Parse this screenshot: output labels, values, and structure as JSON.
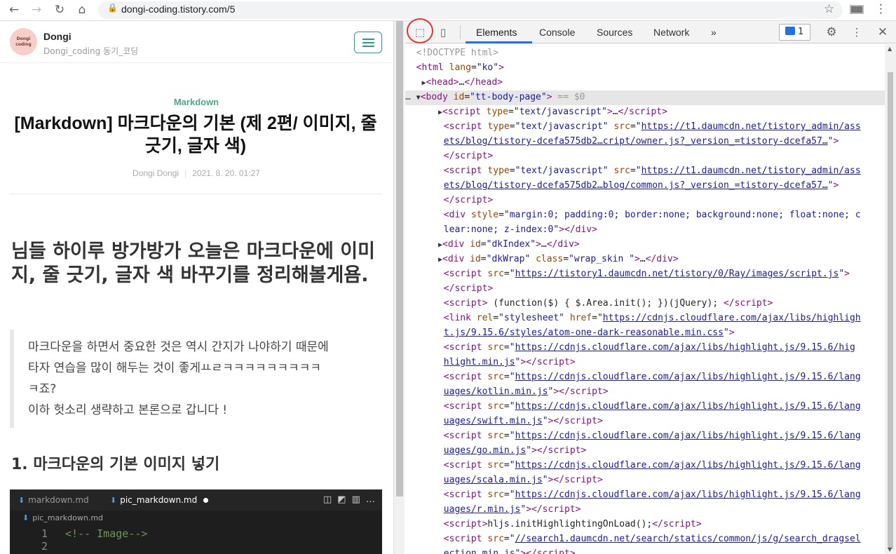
{
  "browser": {
    "url": "dongi-coding.tistory.com/5"
  },
  "blog": {
    "avatar_text": "Dongi\ncoding",
    "name": "Dongi",
    "subtitle": "Dongi_coding 동기_코딩",
    "category": "Markdown",
    "title": "[Markdown] 마크다운의 기본 (제 2편/ 이미지, 줄 긋기, 글자 색)",
    "author": "Dongi Dongi",
    "date": "2021. 8. 20. 01:27",
    "lead": "님들 하이루 방가방가 오늘은 마크다운에 이미지, 줄 긋기, 글자 색 바꾸기를 정리해볼게욤.",
    "quote_lines": [
      "마크다운을 하면서 중요한 것은 역시 간지가 나야하기 때문에",
      "타자 연습을 많이 해두는 것이 좋게ㅛㄹㅋㅋㅋㅋㅋㅋㅋㅋㅋ",
      "ㅋ죠?",
      "이하 헛소리 생략하고 본론으로 갑니다 !"
    ],
    "section_heading": "1. 마크다운의 기본 이미지 넣기"
  },
  "editor": {
    "tab1": "markdown.md",
    "tab2": "pic_markdown.md",
    "breadcrumb": "pic_markdown.md",
    "line1_no": "1",
    "line2_no": "2",
    "line1_code": "<!-- Image-->"
  },
  "devtools": {
    "tabs": [
      "Elements",
      "Console",
      "Sources",
      "Network"
    ],
    "more": "»",
    "message_count": "1",
    "selected_suffix": " == $0"
  }
}
